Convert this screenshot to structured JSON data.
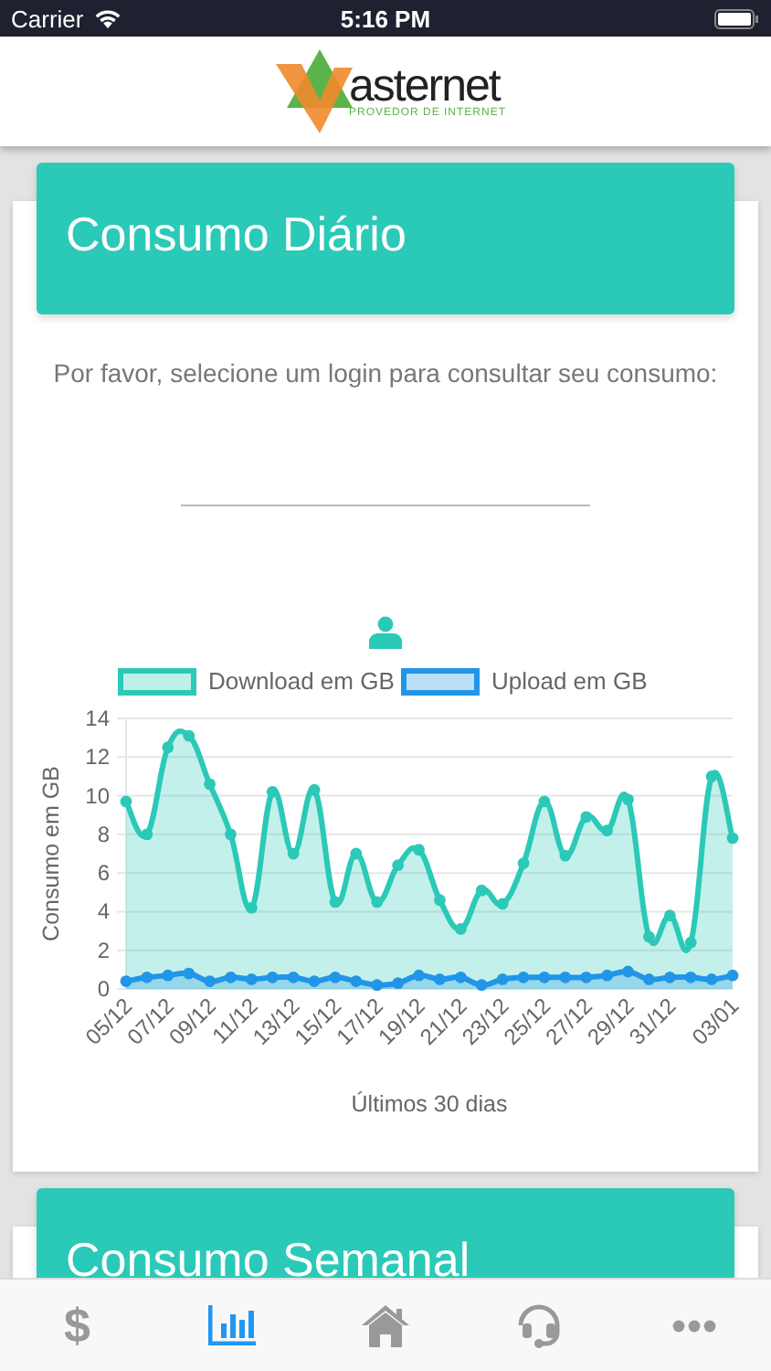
{
  "status_bar": {
    "carrier": "Carrier",
    "time": "5:16 PM"
  },
  "header": {
    "logo_name": "asternet",
    "logo_tagline": "PROVEDOR DE INTERNET"
  },
  "cards": [
    {
      "title": "Consumo Diário",
      "prompt": "Por favor, selecione um login para consultar seu consumo:",
      "has_login_field": true,
      "chart_data": {
        "type": "area",
        "xlabel": "Últimos 30 dias",
        "ylabel": "Consumo em GB",
        "grid": true,
        "legend": "top",
        "categories": [
          "05/12",
          null,
          "07/12",
          null,
          "09/12",
          null,
          "11/12",
          null,
          "13/12",
          null,
          "15/12",
          null,
          "17/12",
          null,
          "19/12",
          null,
          "21/12",
          null,
          "23/12",
          null,
          "25/12",
          null,
          "27/12",
          null,
          "29/12",
          null,
          "31/12",
          null,
          null,
          "03/01"
        ],
        "series": [
          {
            "name": "Download em GB",
            "color": "#2bc9b7",
            "values": [
              9.7,
              8.0,
              12.5,
              13.1,
              10.6,
              8.0,
              4.2,
              10.2,
              7.0,
              10.3,
              4.5,
              7.0,
              4.5,
              6.4,
              7.2,
              4.6,
              3.1,
              5.1,
              4.4,
              6.5,
              9.7,
              6.9,
              8.9,
              8.2,
              9.8,
              2.7,
              3.8,
              2.4,
              11.0,
              7.8
            ]
          },
          {
            "name": "Upload em GB",
            "color": "#2196e8",
            "values": [
              0.4,
              0.6,
              0.7,
              0.8,
              0.4,
              0.6,
              0.5,
              0.6,
              0.6,
              0.4,
              0.6,
              0.4,
              0.2,
              0.3,
              0.7,
              0.5,
              0.6,
              0.2,
              0.5,
              0.6,
              0.6,
              0.6,
              0.6,
              0.7,
              0.9,
              0.5,
              0.6,
              0.6,
              0.5,
              0.7
            ]
          }
        ],
        "ylim": [
          0,
          14
        ],
        "yticks": [
          0,
          2,
          4,
          6,
          8,
          10,
          12,
          14
        ]
      }
    },
    {
      "title": "Consumo Semanal"
    }
  ],
  "tab_bar": [
    {
      "kind": "dollar",
      "label": "$",
      "selected": false
    },
    {
      "kind": "chart",
      "selected": true
    },
    {
      "kind": "home",
      "selected": false
    },
    {
      "kind": "headset",
      "selected": false
    },
    {
      "kind": "more",
      "selected": false
    }
  ]
}
